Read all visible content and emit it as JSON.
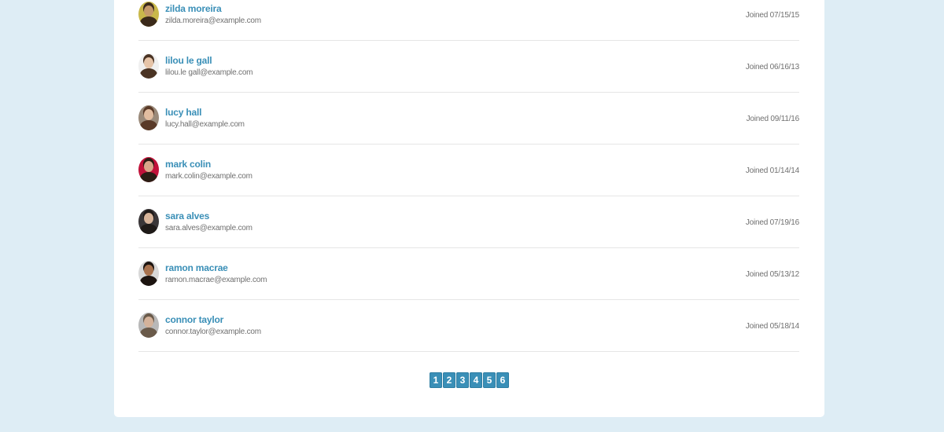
{
  "users": [
    {
      "name": "zilda moreira",
      "email": "zilda.moreira@example.com",
      "joined": "Joined 07/15/15",
      "skin": "#c59a6a",
      "hair": "#3b2a1a",
      "bg": "#c9b84a"
    },
    {
      "name": "lilou le gall",
      "email": "lilou.le gall@example.com",
      "joined": "Joined 06/16/13",
      "skin": "#e6c4a8",
      "hair": "#4a3323",
      "bg": "#f0f0f0"
    },
    {
      "name": "lucy hall",
      "email": "lucy.hall@example.com",
      "joined": "Joined 09/11/16",
      "skin": "#e2bda0",
      "hair": "#5a3a28",
      "bg": "#9a8a7a"
    },
    {
      "name": "mark colin",
      "email": "mark.colin@example.com",
      "joined": "Joined 01/14/14",
      "skin": "#d9a88a",
      "hair": "#2b1d14",
      "bg": "#c1123a"
    },
    {
      "name": "sara alves",
      "email": "sara.alves@example.com",
      "joined": "Joined 07/19/16",
      "skin": "#d8b49a",
      "hair": "#1f1a18",
      "bg": "#3a3638"
    },
    {
      "name": "ramon macrae",
      "email": "ramon.macrae@example.com",
      "joined": "Joined 05/13/12",
      "skin": "#a8724e",
      "hair": "#1c1410",
      "bg": "#d8d8d8"
    },
    {
      "name": "connor taylor",
      "email": "connor.taylor@example.com",
      "joined": "Joined 05/18/14",
      "skin": "#d4b29a",
      "hair": "#6a5a4a",
      "bg": "#b8b8b8"
    }
  ],
  "pagination": {
    "pages": [
      "1",
      "2",
      "3",
      "4",
      "5",
      "6"
    ]
  },
  "colors": {
    "page_bg": "#deedf5",
    "accent": "#3a8fb7",
    "muted_text": "#707070"
  }
}
